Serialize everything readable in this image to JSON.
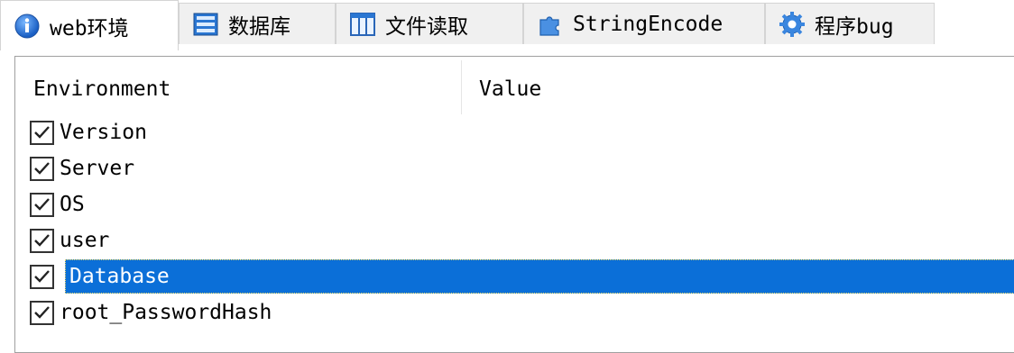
{
  "tabs": [
    {
      "label": "web环境",
      "icon": "info-icon",
      "active": true
    },
    {
      "label": "数据库",
      "icon": "database-icon",
      "active": false
    },
    {
      "label": "文件读取",
      "icon": "columns-icon",
      "active": false
    },
    {
      "label": "StringEncode",
      "icon": "puzzle-icon",
      "active": false
    },
    {
      "label": "程序bug",
      "icon": "gear-icon",
      "active": false
    }
  ],
  "columns": {
    "environment": "Environment",
    "value": "Value"
  },
  "rows": [
    {
      "label": "Version",
      "checked": true,
      "selected": false
    },
    {
      "label": "Server",
      "checked": true,
      "selected": false
    },
    {
      "label": "OS",
      "checked": true,
      "selected": false
    },
    {
      "label": "user",
      "checked": true,
      "selected": false
    },
    {
      "label": "Database",
      "checked": true,
      "selected": true
    },
    {
      "label": "root_PasswordHash",
      "checked": true,
      "selected": false
    }
  ],
  "colors": {
    "selection": "#0b6fd8",
    "tab_bg": "#f0f0f0",
    "border": "#a0a0a0"
  }
}
